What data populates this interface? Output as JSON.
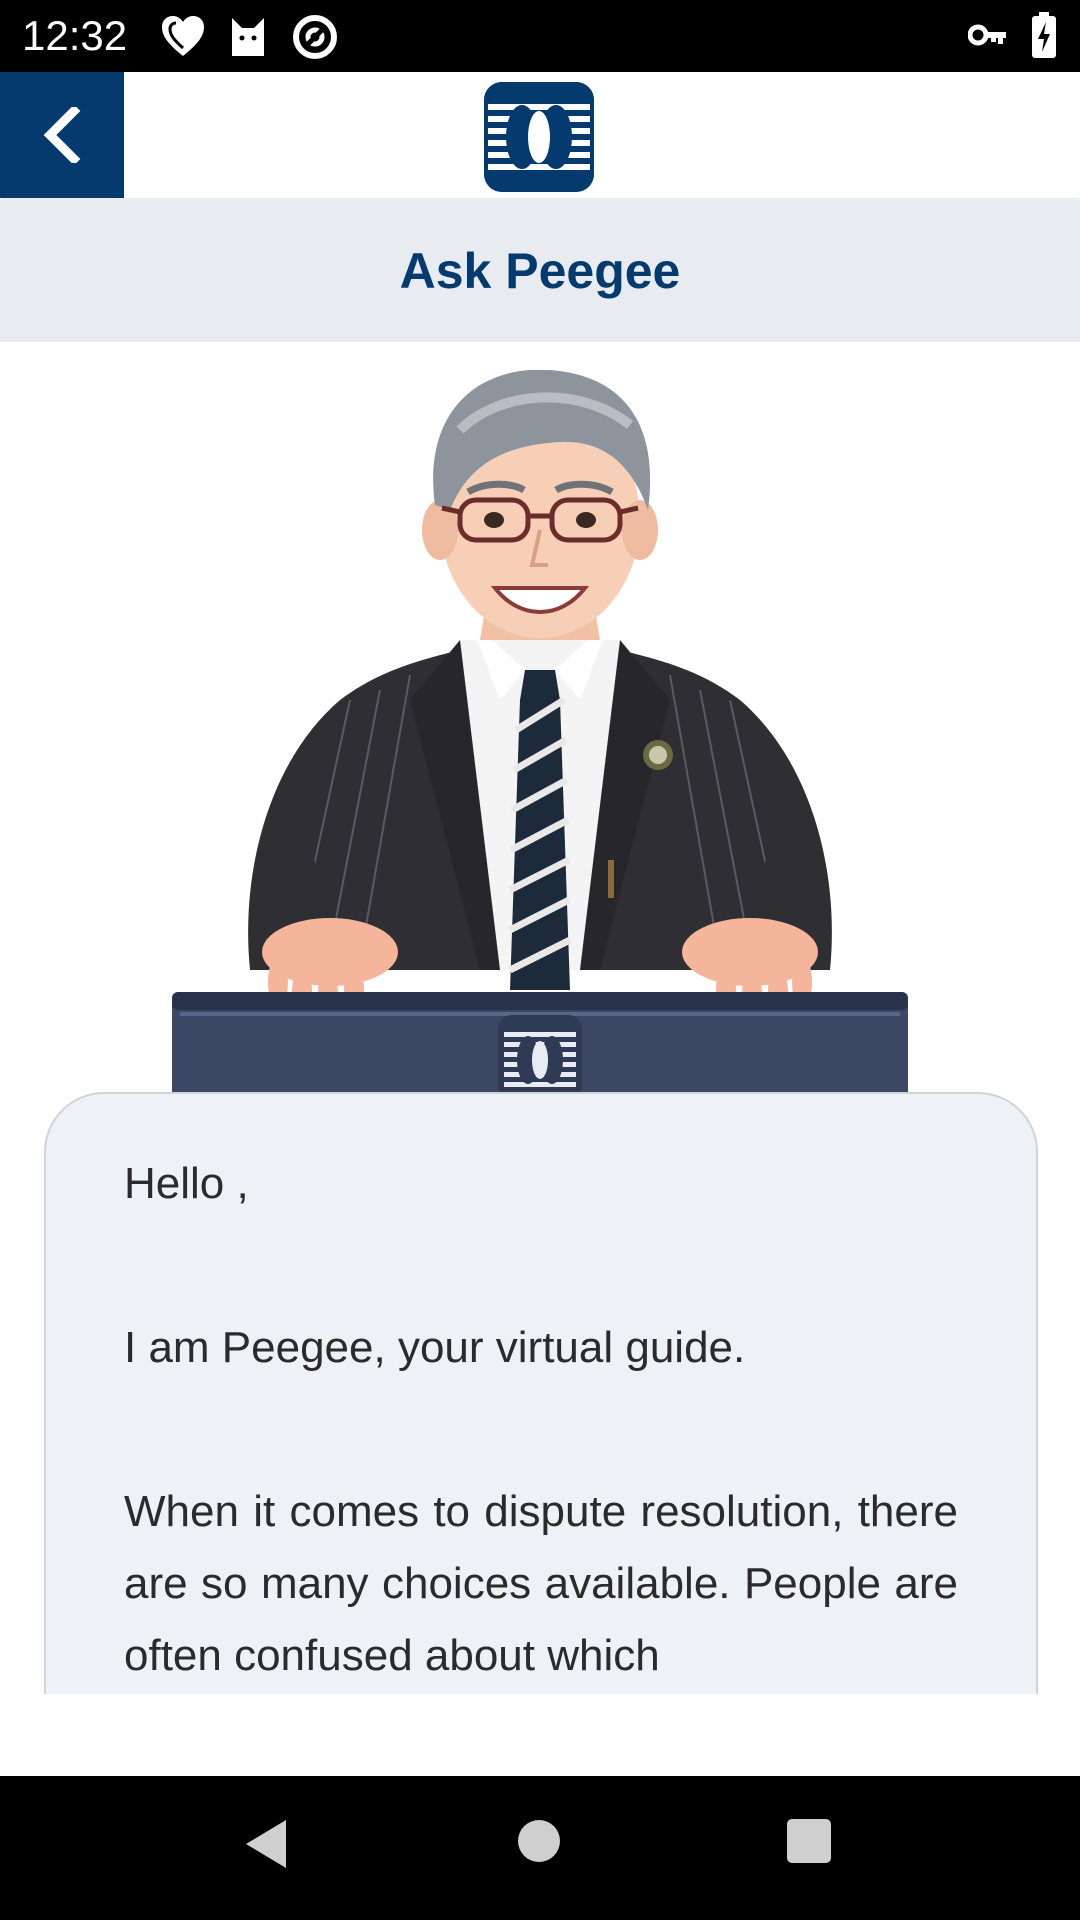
{
  "status_bar": {
    "time": "12:32",
    "left_icons": [
      "heart-icon",
      "cat-icon",
      "at-sign-icon"
    ],
    "right_icons": [
      "vpn-key-icon",
      "battery-charging-icon"
    ]
  },
  "header": {
    "back_icon": "chevron-left-icon",
    "logo": "app-logo",
    "brand_color": "#053a6e"
  },
  "title": "Ask Peegee",
  "message": {
    "paragraphs": [
      "Hello ,",
      "I am Peegee, your virtual guide.",
      "When it comes to dispute resolution, there are so many choices available. People are often confused about which"
    ]
  },
  "nav_bar": {
    "buttons": [
      "back-triangle-icon",
      "home-circle-icon",
      "recents-square-icon"
    ]
  }
}
